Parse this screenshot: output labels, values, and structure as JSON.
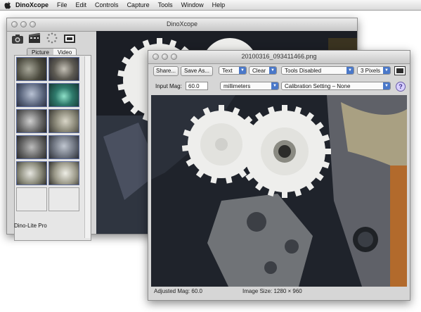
{
  "menubar": {
    "app_name": "DinoXcope",
    "items": [
      "File",
      "Edit",
      "Controls",
      "Capture",
      "Tools",
      "Window",
      "Help"
    ]
  },
  "back_window": {
    "title": "DinoXcope",
    "tabs": {
      "picture": "Picture",
      "video": "Video",
      "selected": "Picture"
    },
    "status": "Dino-Lite Pro",
    "toolbar_icons": [
      "camera-icon",
      "film-icon",
      "settings-icon",
      "fullscreen-icon"
    ]
  },
  "front_window": {
    "title": "20100316_093411466.png",
    "share_label": "Share...",
    "save_as_label": "Save As...",
    "text_label": "Text",
    "clear_label": "Clear",
    "tools_value": "Tools Disabled",
    "pixels_value": "3 Pixels",
    "input_mag_label": "Input Mag:",
    "input_mag_value": "60.0",
    "unit_value": "millimeters",
    "calibration_value": "Calibration Setting – None",
    "help_label": "?",
    "adjusted_mag": "Adjusted Mag:  60.0",
    "image_size": "Image Size:  1280 × 960"
  }
}
